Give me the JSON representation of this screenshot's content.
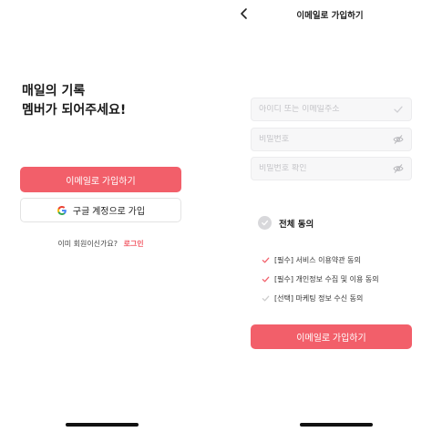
{
  "left": {
    "headline_line1": "매일의 기록",
    "headline_line2": "멤버가 되어주세요!",
    "email_signup_label": "이메일로 가입하기",
    "google_signup_label": "구글 계정으로 가입",
    "existing_member_text": "이미 회원이신가요?",
    "login_link": "로그인"
  },
  "right": {
    "title": "이메일로 가입하기",
    "back_icon": "chevron-left-icon",
    "fields": [
      {
        "placeholder": "아이디 또는 이메일주소",
        "value": "",
        "icon": "check-icon"
      },
      {
        "placeholder": "비밀번호",
        "value": "",
        "icon": "eye-off-icon"
      },
      {
        "placeholder": "비밀번호 확인",
        "value": "",
        "icon": "eye-off-icon"
      }
    ],
    "agree_all_label": "전체 동의",
    "terms": [
      {
        "label": "[필수] 서비스 이용약관 동의",
        "checked": true
      },
      {
        "label": "[필수] 개인정보 수집 및 이용 동의",
        "checked": true
      },
      {
        "label": "[선택] 마케팅 정보 수신 동의",
        "checked": false
      }
    ],
    "submit_label": "이메일로 가입하기"
  },
  "colors": {
    "accent": "#f25f6a",
    "field_bg": "#f7f7f8",
    "placeholder": "#c4c4c8",
    "checked_mark": "#f25f6a",
    "unchecked_mark": "#cccccc"
  }
}
